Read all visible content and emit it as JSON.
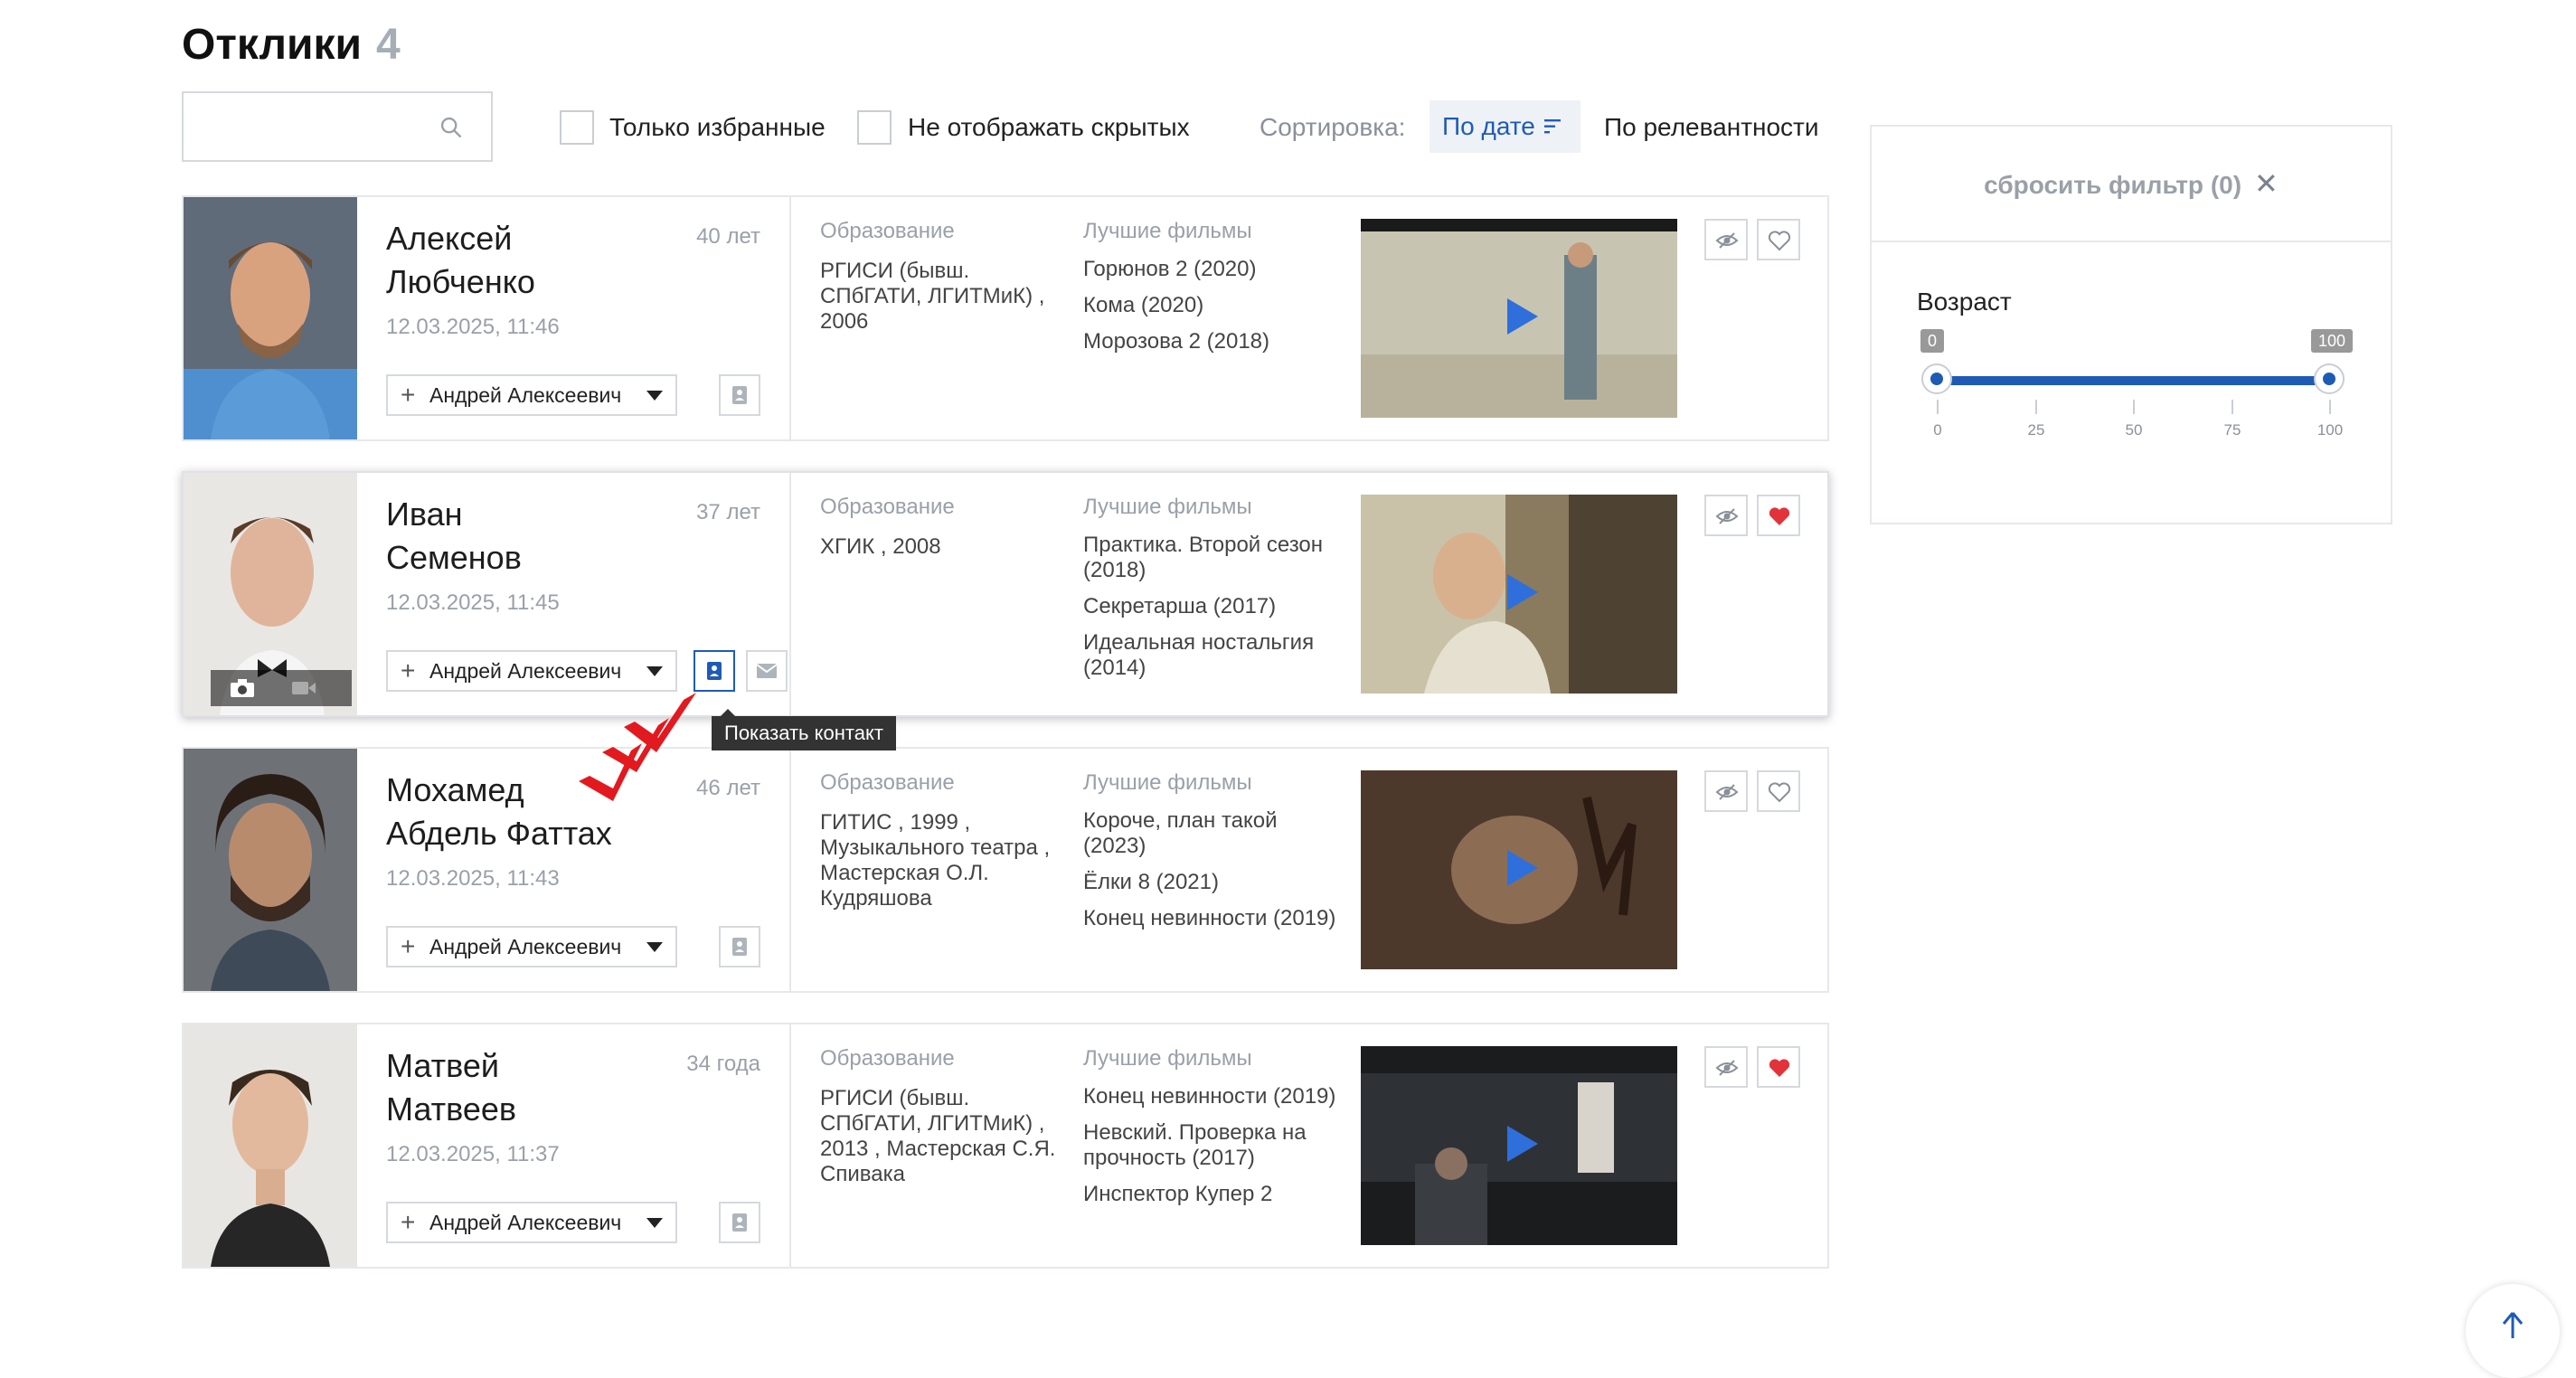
{
  "page": {
    "title": "Отклики",
    "count": "4"
  },
  "search": {
    "placeholder": ""
  },
  "filters": {
    "only_favorites_label": "Только избранные",
    "hide_hidden_label": "Не отображать скрытых",
    "sort_label": "Сортировка:",
    "sort_by_date": "По дате",
    "sort_by_relevance": "По релевантности"
  },
  "labels": {
    "education": "Образование",
    "best_films": "Лучшие фильмы"
  },
  "candidates": [
    {
      "name_line1": "Алексей",
      "name_line2": "Любченко",
      "age": "40 лет",
      "date": "12.03.2025, 11:46",
      "agent": "Андрей Алексеевич",
      "education": "РГИСИ (бывш. СПбГАТИ, ЛГИТМиК) , 2006",
      "films": [
        "Горюнов 2 (2020)",
        "Кома (2020)",
        "Морозова 2 (2018)"
      ],
      "favorite": false
    },
    {
      "name_line1": "Иван",
      "name_line2": "Семенов",
      "age": "37 лет",
      "date": "12.03.2025, 11:45",
      "agent": "Андрей Алексеевич",
      "education": "ХГИК , 2008",
      "films": [
        "Практика. Второй сезон (2018)",
        "Секретарша (2017)",
        "Идеальная ностальгия (2014)"
      ],
      "favorite": true
    },
    {
      "name_line1": "Мохамед",
      "name_line2": "Абдель Фаттах",
      "age": "46 лет",
      "date": "12.03.2025, 11:43",
      "agent": "Андрей Алексеевич",
      "education": "ГИТИС , 1999 , Музыкального театра , Мастерская О.Л. Кудряшова",
      "films": [
        "Короче, план такой (2023)",
        "Ёлки 8 (2021)",
        "Конец невинности (2019)"
      ],
      "favorite": false
    },
    {
      "name_line1": "Матвей",
      "name_line2": "Матвеев",
      "age": "34 года",
      "date": "12.03.2025, 11:37",
      "agent": "Андрей Алексеевич",
      "education": "РГИСИ (бывш. СПбГАТИ, ЛГИТМиК) , 2013 , Мастерская С.Я. Спивака",
      "films": [
        "Конец невинности (2019)",
        "Невский. Проверка на прочность (2017)",
        "Инспектор Купер 2"
      ],
      "favorite": true
    }
  ],
  "tooltip": "Показать контакт",
  "filter_panel": {
    "reset_label": "сбросить фильтр (0)",
    "age_title": "Возраст",
    "age_min": "0",
    "age_max": "100",
    "ticks": [
      "0",
      "25",
      "50",
      "75",
      "100"
    ]
  },
  "colors": {
    "accent": "#1f5bb5",
    "favorite": "#e2333b",
    "annotation_arrow": "#e2191f"
  },
  "icons": [
    "search-icon",
    "sort-icon",
    "plus-icon",
    "contact-icon",
    "mail-icon",
    "hide-icon",
    "heart-icon",
    "camera-icon",
    "video-icon",
    "play-icon",
    "close-icon",
    "arrow-up-icon"
  ]
}
